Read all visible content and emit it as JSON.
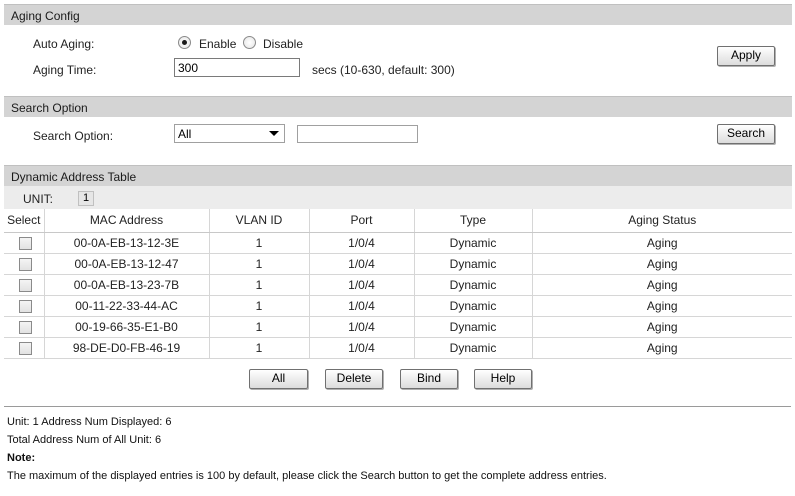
{
  "aging_config": {
    "header": "Aging Config",
    "auto_aging_label": "Auto Aging:",
    "enable_label": "Enable",
    "disable_label": "Disable",
    "aging_time_label": "Aging Time:",
    "aging_time_value": "300",
    "aging_time_hint": "secs (10-630, default: 300)",
    "apply_label": "Apply"
  },
  "search_option": {
    "header": "Search Option",
    "label": "Search Option:",
    "selected": "All",
    "search_value": "",
    "search_label": "Search"
  },
  "dynamic_table": {
    "header": "Dynamic Address Table",
    "unit_label": "UNIT:",
    "unit_value": "1",
    "columns": [
      "Select",
      "MAC Address",
      "VLAN ID",
      "Port",
      "Type",
      "Aging Status"
    ],
    "rows": [
      {
        "mac": "00-0A-EB-13-12-3E",
        "vlan": "1",
        "port": "1/0/4",
        "type": "Dynamic",
        "status": "Aging"
      },
      {
        "mac": "00-0A-EB-13-12-47",
        "vlan": "1",
        "port": "1/0/4",
        "type": "Dynamic",
        "status": "Aging"
      },
      {
        "mac": "00-0A-EB-13-23-7B",
        "vlan": "1",
        "port": "1/0/4",
        "type": "Dynamic",
        "status": "Aging"
      },
      {
        "mac": "00-11-22-33-44-AC",
        "vlan": "1",
        "port": "1/0/4",
        "type": "Dynamic",
        "status": "Aging"
      },
      {
        "mac": "00-19-66-35-E1-B0",
        "vlan": "1",
        "port": "1/0/4",
        "type": "Dynamic",
        "status": "Aging"
      },
      {
        "mac": "98-DE-D0-FB-46-19",
        "vlan": "1",
        "port": "1/0/4",
        "type": "Dynamic",
        "status": "Aging"
      }
    ],
    "buttons": {
      "all": "All",
      "delete": "Delete",
      "bind": "Bind",
      "help": "Help"
    }
  },
  "footer": {
    "unit_line": "Unit: 1   Address Num Displayed: 6",
    "total_line": "Total Address Num of All Unit:  6",
    "note_title": "Note:",
    "note_text": "The maximum of the displayed entries is 100 by default, please click the Search button to get the complete address entries."
  }
}
